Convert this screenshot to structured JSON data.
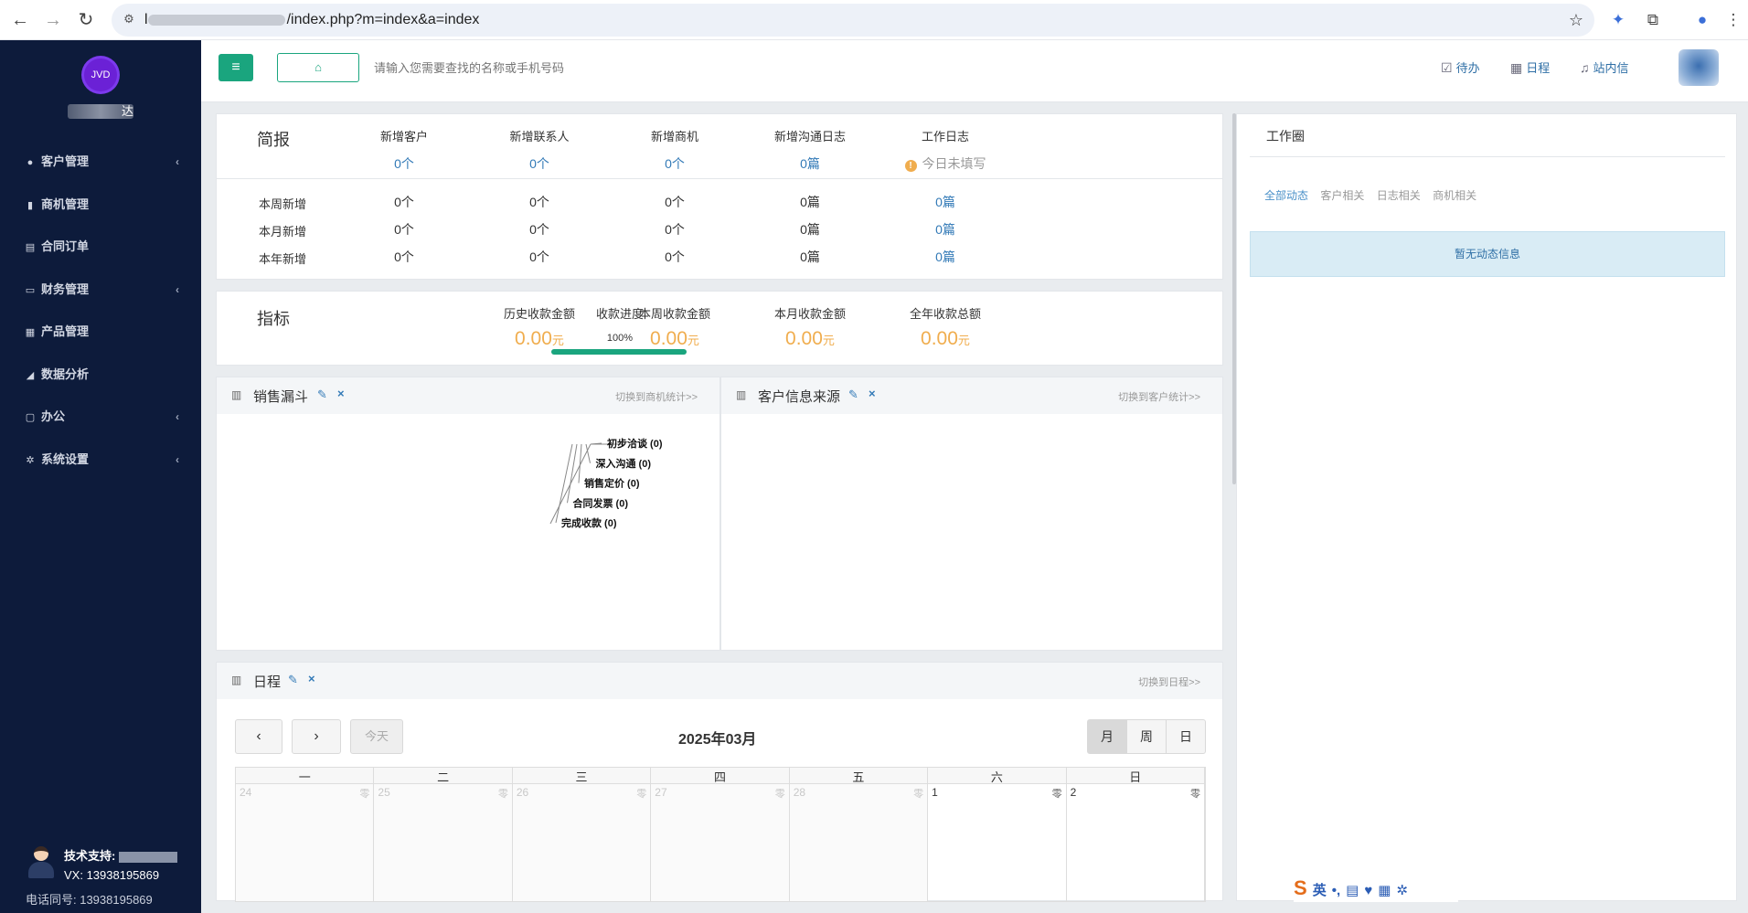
{
  "browser": {
    "url_suffix": "/index.php?m=index&a=index",
    "url_prefix": "l"
  },
  "sidebar": {
    "logo_text": "JVD",
    "company_suffix": "达",
    "items": [
      {
        "label": "客户管理",
        "icon": "user-icon",
        "has_arrow": true
      },
      {
        "label": "商机管理",
        "icon": "briefcase-icon",
        "has_arrow": false
      },
      {
        "label": "合同订单",
        "icon": "list-icon",
        "has_arrow": false
      },
      {
        "label": "财务管理",
        "icon": "credit-card-icon",
        "has_arrow": true
      },
      {
        "label": "产品管理",
        "icon": "grid-icon",
        "has_arrow": false
      },
      {
        "label": "数据分析",
        "icon": "area-chart-icon",
        "has_arrow": false
      },
      {
        "label": "办公",
        "icon": "desktop-icon",
        "has_arrow": true
      },
      {
        "label": "系统设置",
        "icon": "gear-icon",
        "has_arrow": true
      }
    ],
    "arrow_glyph": "‹",
    "support_label": "技术支持:",
    "vx_label": "VX: 13938195869",
    "phone_label": "电话同号: 13938195869"
  },
  "header": {
    "search_placeholder": "请输入您需要查找的名称或手机号码",
    "links": [
      {
        "label": "待办",
        "icon": "calendar-check-icon"
      },
      {
        "label": "日程",
        "icon": "calendar-icon"
      },
      {
        "label": "站内信",
        "icon": "bell-icon"
      }
    ]
  },
  "brief": {
    "title": "简报",
    "columns": [
      "新增客户",
      "新增联系人",
      "新增商机",
      "新增沟通日志",
      "工作日志"
    ],
    "today": [
      "0个",
      "0个",
      "0个",
      "0篇"
    ],
    "worklog_status": "今日未填写",
    "rows": [
      {
        "label": "本周新增",
        "values": [
          "0个",
          "0个",
          "0个",
          "0篇",
          "0篇"
        ]
      },
      {
        "label": "本月新增",
        "values": [
          "0个",
          "0个",
          "0个",
          "0篇",
          "0篇"
        ]
      },
      {
        "label": "本年新增",
        "values": [
          "0个",
          "0个",
          "0个",
          "0篇",
          "0篇"
        ]
      }
    ]
  },
  "metrics": {
    "title": "指标",
    "progress_label": "收款进度",
    "progress_text": "100%",
    "progress_value": 1.0,
    "columns": [
      "历史收款金额",
      "本周收款金额",
      "本月收款金额",
      "全年收款总额"
    ],
    "values": [
      "0.00",
      "0.00",
      "0.00",
      "0.00"
    ],
    "unit": "元"
  },
  "funnel": {
    "title": "销售漏斗",
    "switch_label": "切换到商机统计>>",
    "stages": [
      "初步洽谈 (0)",
      "深入沟通 (0)",
      "销售定价 (0)",
      "合同发票 (0)",
      "完成收款 (0)"
    ]
  },
  "source": {
    "title": "客户信息来源",
    "switch_label": "切换到客户统计>>"
  },
  "schedule": {
    "title": "日程",
    "switch_label": "切换到日程>>",
    "today_label": "今天",
    "month_title": "2025年03月",
    "views": [
      "月",
      "周",
      "日"
    ],
    "weekdays": [
      "一",
      "二",
      "三",
      "四",
      "五",
      "六",
      "日"
    ],
    "days": [
      {
        "num": "24",
        "lunar": "零",
        "other": true
      },
      {
        "num": "25",
        "lunar": "零",
        "other": true
      },
      {
        "num": "26",
        "lunar": "零",
        "other": true
      },
      {
        "num": "27",
        "lunar": "零",
        "other": true
      },
      {
        "num": "28",
        "lunar": "零",
        "other": true
      },
      {
        "num": "1",
        "lunar": "零",
        "other": false
      },
      {
        "num": "2",
        "lunar": "零",
        "other": false
      }
    ]
  },
  "workcircle": {
    "title": "工作圈",
    "tabs": [
      "全部动态",
      "客户相关",
      "日志相关",
      "商机相关"
    ],
    "empty_text": "暂无动态信息"
  },
  "ime": {
    "lang": "英"
  }
}
